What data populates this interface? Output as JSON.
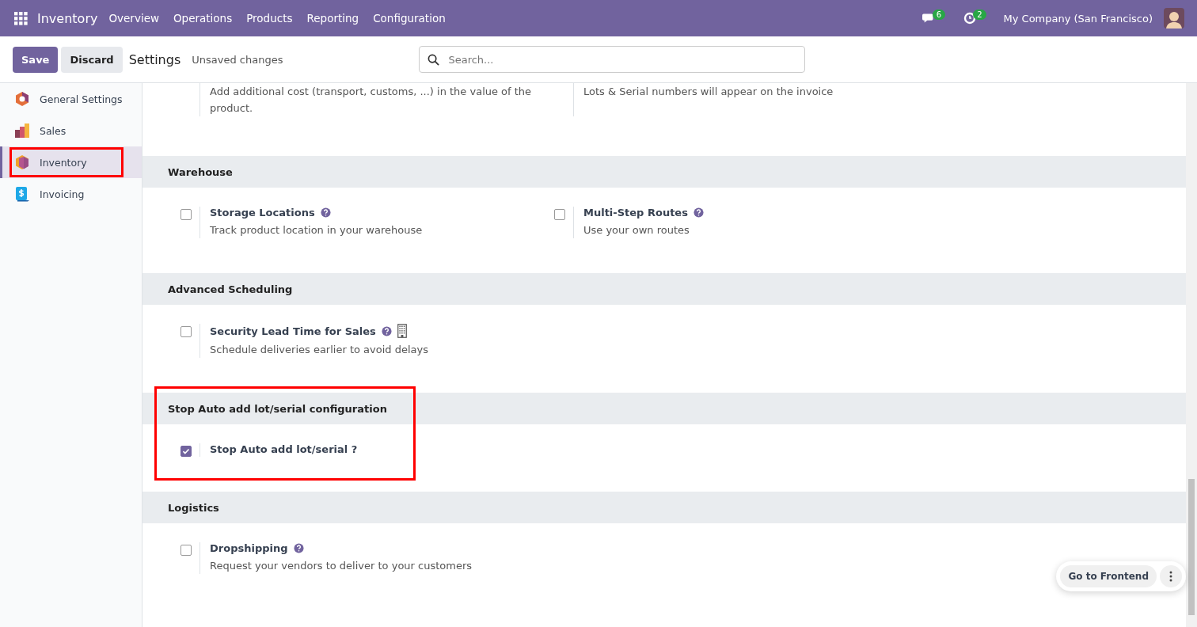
{
  "navbar": {
    "app_name": "Inventory",
    "menu": [
      "Overview",
      "Operations",
      "Products",
      "Reporting",
      "Configuration"
    ],
    "messages_count": "6",
    "activities_count": "2",
    "company": "My Company (San Francisco)"
  },
  "control_panel": {
    "save": "Save",
    "discard": "Discard",
    "title": "Settings",
    "status": "Unsaved changes",
    "search": {
      "placeholder": "Search..."
    }
  },
  "sidebar": {
    "items": [
      {
        "label": "General Settings",
        "kind": "general",
        "selected": false,
        "highlighted": false
      },
      {
        "label": "Sales",
        "kind": "sales",
        "selected": false,
        "highlighted": false
      },
      {
        "label": "Inventory",
        "kind": "inventory",
        "selected": true,
        "highlighted": true
      },
      {
        "label": "Invoicing",
        "kind": "invoicing",
        "selected": false,
        "highlighted": false
      }
    ]
  },
  "sections": [
    {
      "settings": [
        {
          "description": "Add additional cost (transport, customs, ...) in the value of the product."
        },
        {
          "description": "Lots & Serial numbers will appear on the invoice"
        }
      ],
      "highlighted": false
    },
    {
      "title": "Warehouse",
      "highlighted": false,
      "settings": [
        {
          "title": "Storage Locations",
          "description": "Track product location in your warehouse",
          "checked": false,
          "help": true,
          "company_icon": false
        },
        {
          "title": "Multi-Step Routes",
          "description": "Use your own routes",
          "checked": false,
          "help": true,
          "company_icon": false
        }
      ]
    },
    {
      "title": "Advanced Scheduling",
      "highlighted": false,
      "settings": [
        {
          "title": "Security Lead Time for Sales",
          "description": "Schedule deliveries earlier to avoid delays",
          "checked": false,
          "help": true,
          "company_icon": true
        }
      ]
    },
    {
      "title": "Stop Auto add lot/serial configuration",
      "highlighted": true,
      "settings": [
        {
          "title": "Stop Auto add lot/serial ?",
          "checked": true,
          "help": false,
          "company_icon": false
        }
      ]
    },
    {
      "title": "Logistics",
      "highlighted": false,
      "settings": [
        {
          "title": "Dropshipping",
          "description": "Request your vendors to deliver to your customers",
          "checked": false,
          "help": true,
          "company_icon": false
        }
      ]
    }
  ],
  "frontend_button": "Go to Frontend"
}
